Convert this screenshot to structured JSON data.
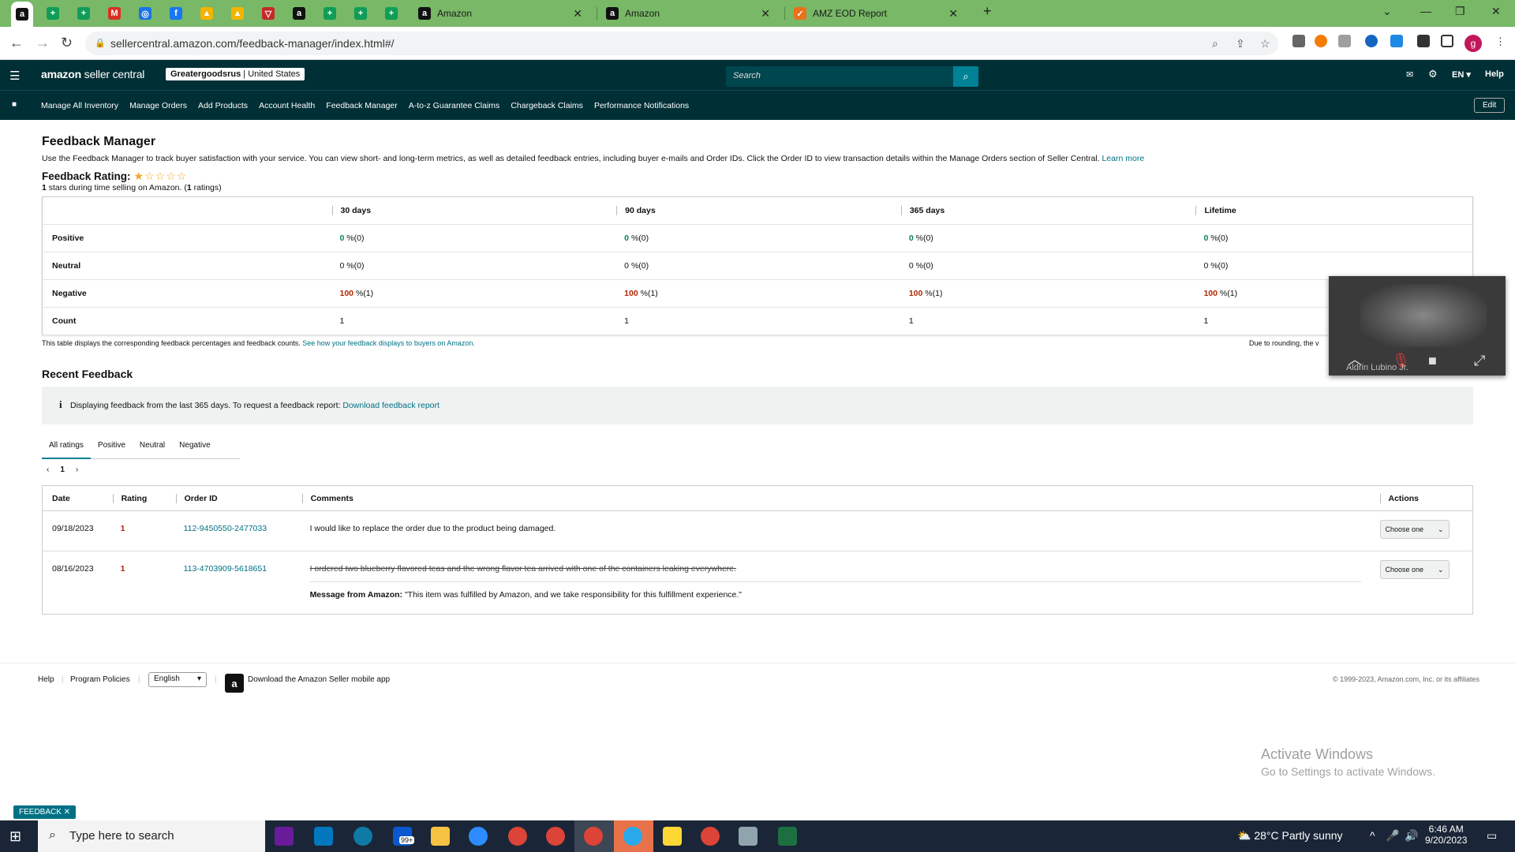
{
  "browser": {
    "pinned_tabs": [
      {
        "icon": "amazon-icon",
        "glyph": "a",
        "color": "#111111"
      },
      {
        "icon": "sheets-icon",
        "glyph": "+",
        "color": "#0f9d58"
      },
      {
        "icon": "sheets-icon",
        "glyph": "+",
        "color": "#0f9d58"
      },
      {
        "icon": "gmail-icon",
        "glyph": "M",
        "color": "#d93025"
      },
      {
        "icon": "sync-icon",
        "glyph": "◎",
        "color": "#1a73e8"
      },
      {
        "icon": "facebook-icon",
        "glyph": "f",
        "color": "#1877f2"
      },
      {
        "icon": "drive-icon",
        "glyph": "▲",
        "color": "#f4b400"
      },
      {
        "icon": "drive-icon",
        "glyph": "▲",
        "color": "#f4b400"
      },
      {
        "icon": "helium10-icon",
        "glyph": "▽",
        "color": "#c62828"
      },
      {
        "icon": "amazon-icon",
        "glyph": "a",
        "color": "#111111"
      },
      {
        "icon": "sheets-icon",
        "glyph": "+",
        "color": "#0f9d58"
      },
      {
        "icon": "sheets-icon",
        "glyph": "+",
        "color": "#0f9d58"
      },
      {
        "icon": "sheets-icon",
        "glyph": "+",
        "color": "#0f9d58"
      }
    ],
    "tabs": [
      {
        "title": "Amazon",
        "icon": "amazon-icon"
      },
      {
        "title": "Amazon",
        "icon": "amazon-icon"
      },
      {
        "title": "AMZ EOD Report",
        "icon": "report-icon"
      }
    ],
    "url": "sellercentral.amazon.com/feedback-manager/index.html#/"
  },
  "seller_central": {
    "logo_brand": "amazon",
    "logo_product": "seller central",
    "account_store": "Greatergoodsrus",
    "account_region": "United States",
    "search_placeholder": "Search",
    "language": "EN",
    "help": "Help",
    "nav": [
      "Manage All Inventory",
      "Manage Orders",
      "Add Products",
      "Account Health",
      "Feedback Manager",
      "A-to-z Guarantee Claims",
      "Chargeback Claims",
      "Performance Notifications"
    ],
    "edit": "Edit"
  },
  "page": {
    "title": "Feedback Manager",
    "intro": "Use the Feedback Manager to track buyer satisfaction with your service. You can view short- and long-term metrics, as well as detailed feedback entries, including buyer e-mails and Order IDs. Click the Order ID to view transaction details within the Manage Orders section of Seller Central.",
    "learn_more": "Learn more",
    "rating_label": "Feedback Rating:",
    "rating_stars": 1,
    "rating_max": 5,
    "rating_summary_count": "1",
    "rating_summary_text": "stars during time selling on Amazon. (",
    "rating_summary_ratings": "1",
    "rating_summary_end": "ratings)",
    "table_headers": [
      "30 days",
      "90 days",
      "365 days",
      "Lifetime"
    ],
    "table_rows": [
      {
        "label": "Positive",
        "cells": [
          {
            "v": "0",
            "s": "%(0)"
          },
          {
            "v": "0",
            "s": "%(0)"
          },
          {
            "v": "0",
            "s": "%(0)"
          },
          {
            "v": "0",
            "s": "%(0)"
          }
        ]
      },
      {
        "label": "Neutral",
        "cells": [
          {
            "v": "0",
            "s": "%(0)"
          },
          {
            "v": "0",
            "s": "%(0)"
          },
          {
            "v": "0",
            "s": "%(0)"
          },
          {
            "v": "0",
            "s": "%(0)"
          }
        ]
      },
      {
        "label": "Negative",
        "cells": [
          {
            "v": "100",
            "s": "%(1)"
          },
          {
            "v": "100",
            "s": "%(1)"
          },
          {
            "v": "100",
            "s": "%(1)"
          },
          {
            "v": "100",
            "s": "%(1)"
          }
        ]
      },
      {
        "label": "Count",
        "cells": [
          {
            "v": "1",
            "s": ""
          },
          {
            "v": "1",
            "s": ""
          },
          {
            "v": "1",
            "s": ""
          },
          {
            "v": "1",
            "s": ""
          }
        ]
      }
    ],
    "table_note": "This table displays the corresponding feedback percentages and feedback counts.",
    "table_note_link": "See how your feedback displays to buyers on Amazon.",
    "table_note_right": "Due to rounding, the v",
    "recent_title": "Recent Feedback",
    "banner_text": "Displaying feedback from the last 365 days. To request a feedback report:",
    "banner_link": "Download feedback report",
    "filter_tabs": [
      "All ratings",
      "Positive",
      "Neutral",
      "Negative"
    ],
    "page_number": "1",
    "feedback_headers": [
      "Date",
      "Rating",
      "Order ID",
      "Comments",
      "Actions"
    ],
    "feedback": [
      {
        "date": "09/18/2023",
        "rating": "1",
        "order": "112-9450550-2477033",
        "comment": "I would like to replace the order due to the product being damaged.",
        "action": "Choose one"
      },
      {
        "date": "08/16/2023",
        "rating": "1",
        "order": "113-4703909-5618651",
        "comment": "I ordered two blueberry flavored teas and the wrong flavor tea arrived with one of the containers leaking everywhere.",
        "message_label": "Message from Amazon:",
        "message": "\"This item was fulfilled by Amazon, and we take responsibility for this fulfillment experience.\"",
        "action": "Choose one"
      }
    ]
  },
  "footer": {
    "help": "Help",
    "policies": "Program Policies",
    "language": "English",
    "app": "Download the Amazon Seller mobile app",
    "copyright": "© 1999-2023, Amazon.com, Inc. or its affiliates"
  },
  "overlay": {
    "call_name": "Aldrin Lubino Jr.",
    "activate_title": "Activate Windows",
    "activate_sub": "Go to Settings to activate Windows.",
    "feedback_badge": "FEEDBACK ✕"
  },
  "taskbar": {
    "search_placeholder": "Type here to search",
    "mail_badge": "99+",
    "weather": "28°C  Partly sunny",
    "time": "6:46 AM",
    "date": "9/20/2023"
  }
}
